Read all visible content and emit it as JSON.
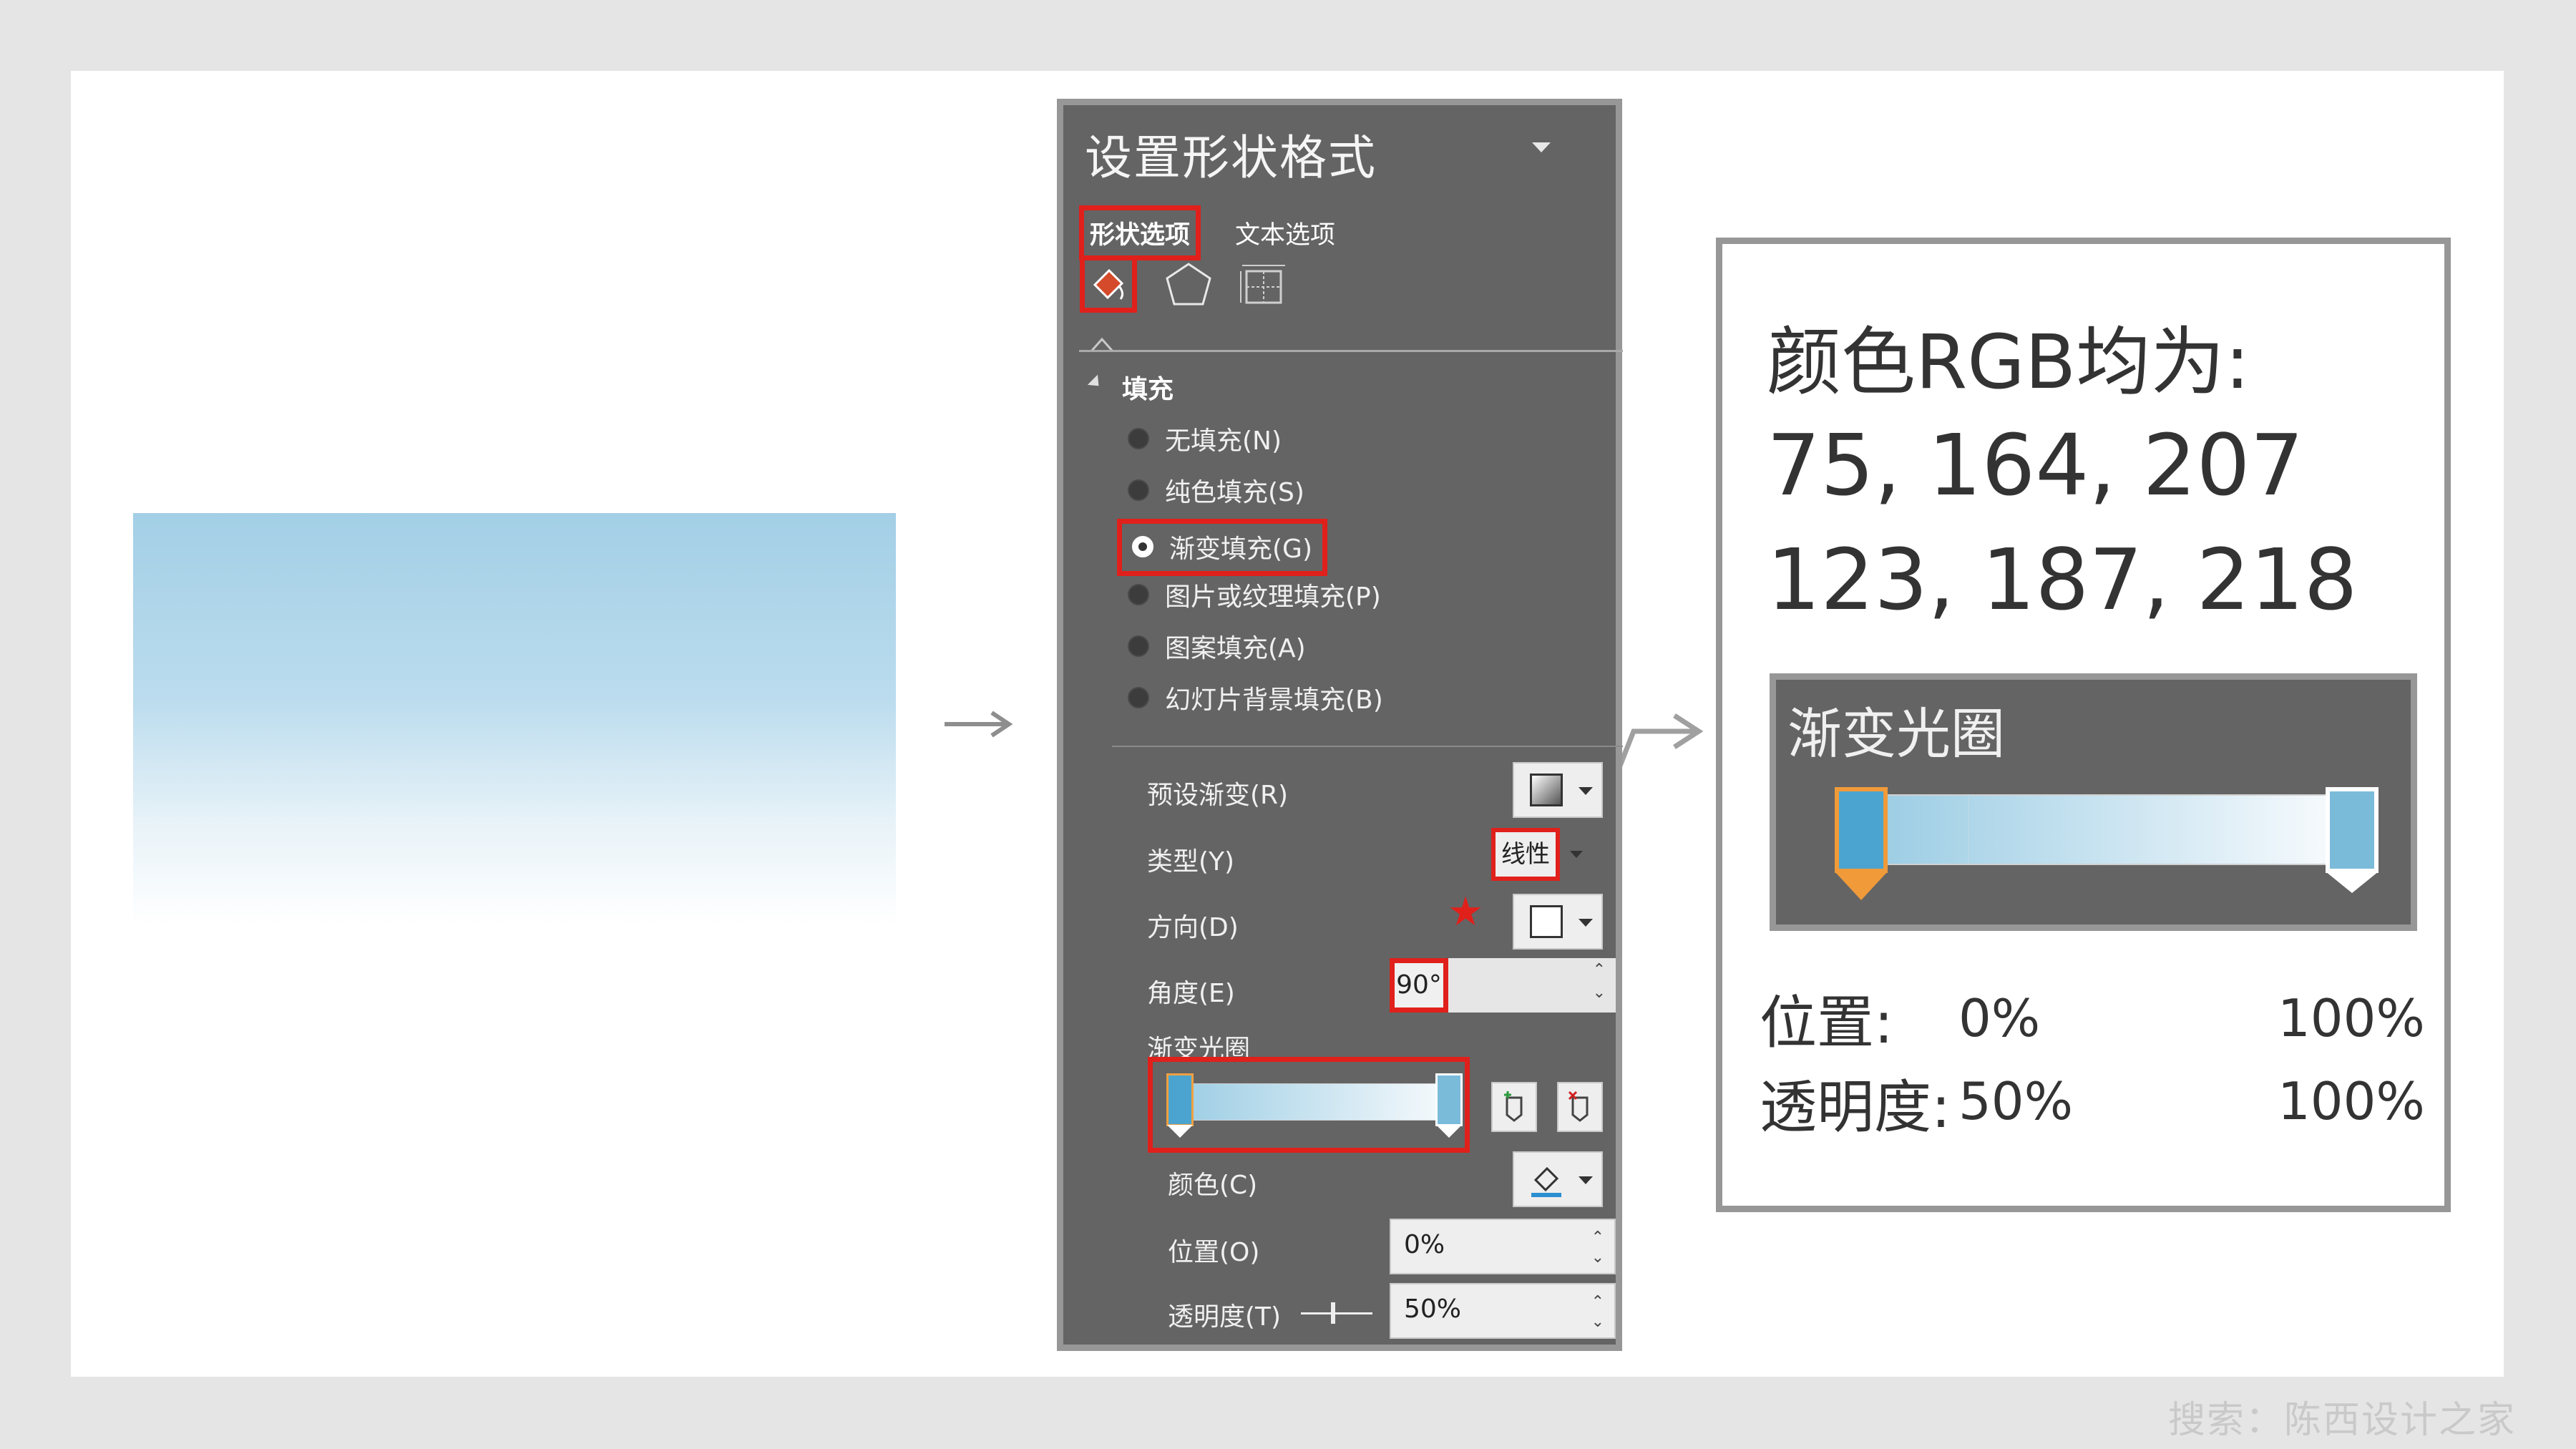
{
  "panel": {
    "title": "设置形状格式",
    "tabs": {
      "shape": "形状选项",
      "text": "文本选项"
    },
    "icons": {
      "fill": "fill-line-icon",
      "effects": "pentagon-icon",
      "size": "size-properties-icon"
    },
    "section": "填充",
    "fill_options": [
      {
        "label": "无填充(N)",
        "selected": false
      },
      {
        "label": "纯色填充(S)",
        "selected": false
      },
      {
        "label": "渐变填充(G)",
        "selected": true
      },
      {
        "label": "图片或纹理填充(P)",
        "selected": false
      },
      {
        "label": "图案填充(A)",
        "selected": false
      },
      {
        "label": "幻灯片背景填充(B)",
        "selected": false
      }
    ],
    "props": {
      "preset": "预设渐变(R)",
      "type": "类型(Y)",
      "type_value": "线性",
      "direction": "方向(D)",
      "angle": "角度(E)",
      "angle_value": "90°",
      "stops": "渐变光圈",
      "color": "颜色(C)",
      "position": "位置(O)",
      "position_value": "0%",
      "transparency": "透明度(T)",
      "transparency_value": "50%"
    }
  },
  "callout": {
    "title": "颜色RGB均为:",
    "rgb1": "75, 164, 207",
    "rgb2": "123, 187, 218",
    "stops_title": "渐变光圈",
    "position_label": "位置:",
    "position_left": "0%",
    "position_right": "100%",
    "transparency_label": "透明度:",
    "transparency_left": "50%",
    "transparency_right": "100%"
  },
  "watermark": "搜索：陈西设计之家",
  "colors": {
    "highlight": "#e0201b",
    "stop_dark": "#4ba4cf",
    "stop_light": "#7bbbda"
  }
}
